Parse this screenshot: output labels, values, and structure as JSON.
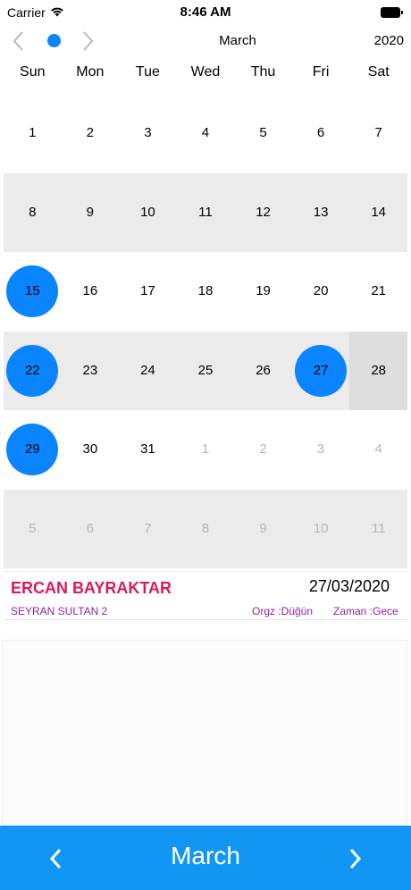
{
  "status_bar": {
    "carrier": "Carrier",
    "time": "8:46 AM"
  },
  "header": {
    "month": "March",
    "year": "2020"
  },
  "weekdays": [
    "Sun",
    "Mon",
    "Tue",
    "Wed",
    "Thu",
    "Fri",
    "Sat"
  ],
  "weeks": [
    [
      {
        "d": "1"
      },
      {
        "d": "2"
      },
      {
        "d": "3"
      },
      {
        "d": "4"
      },
      {
        "d": "5"
      },
      {
        "d": "6"
      },
      {
        "d": "7"
      }
    ],
    [
      {
        "d": "8"
      },
      {
        "d": "9"
      },
      {
        "d": "10"
      },
      {
        "d": "11"
      },
      {
        "d": "12"
      },
      {
        "d": "13"
      },
      {
        "d": "14"
      }
    ],
    [
      {
        "d": "15",
        "event": true
      },
      {
        "d": "16"
      },
      {
        "d": "17"
      },
      {
        "d": "18"
      },
      {
        "d": "19"
      },
      {
        "d": "20"
      },
      {
        "d": "21"
      }
    ],
    [
      {
        "d": "22",
        "event": true
      },
      {
        "d": "23"
      },
      {
        "d": "24"
      },
      {
        "d": "25"
      },
      {
        "d": "26"
      },
      {
        "d": "27",
        "event": true
      },
      {
        "d": "28",
        "selected": true
      }
    ],
    [
      {
        "d": "29",
        "event": true
      },
      {
        "d": "30"
      },
      {
        "d": "31"
      },
      {
        "d": "1",
        "muted": true
      },
      {
        "d": "2",
        "muted": true
      },
      {
        "d": "3",
        "muted": true
      },
      {
        "d": "4",
        "muted": true
      }
    ],
    [
      {
        "d": "5",
        "muted": true
      },
      {
        "d": "6",
        "muted": true
      },
      {
        "d": "7",
        "muted": true
      },
      {
        "d": "8",
        "muted": true
      },
      {
        "d": "9",
        "muted": true
      },
      {
        "d": "10",
        "muted": true
      },
      {
        "d": "11",
        "muted": true
      }
    ]
  ],
  "event": {
    "name": "ERCAN BAYRAKTAR",
    "date": "27/03/2020",
    "place": "SEYRAN SULTAN 2",
    "org": "Orgz :Düğün",
    "time": "Zaman :Gece"
  },
  "bottom_bar": {
    "month": "March"
  },
  "colors": {
    "accent": "#0a84ff",
    "bottom_bar": "#1296f3",
    "event_name": "#d81b60",
    "event_meta": "#8e24aa",
    "row_shade": "#ebebeb"
  },
  "icons": [
    "wifi-icon",
    "battery-icon",
    "chevron-left-icon",
    "chevron-right-icon"
  ]
}
